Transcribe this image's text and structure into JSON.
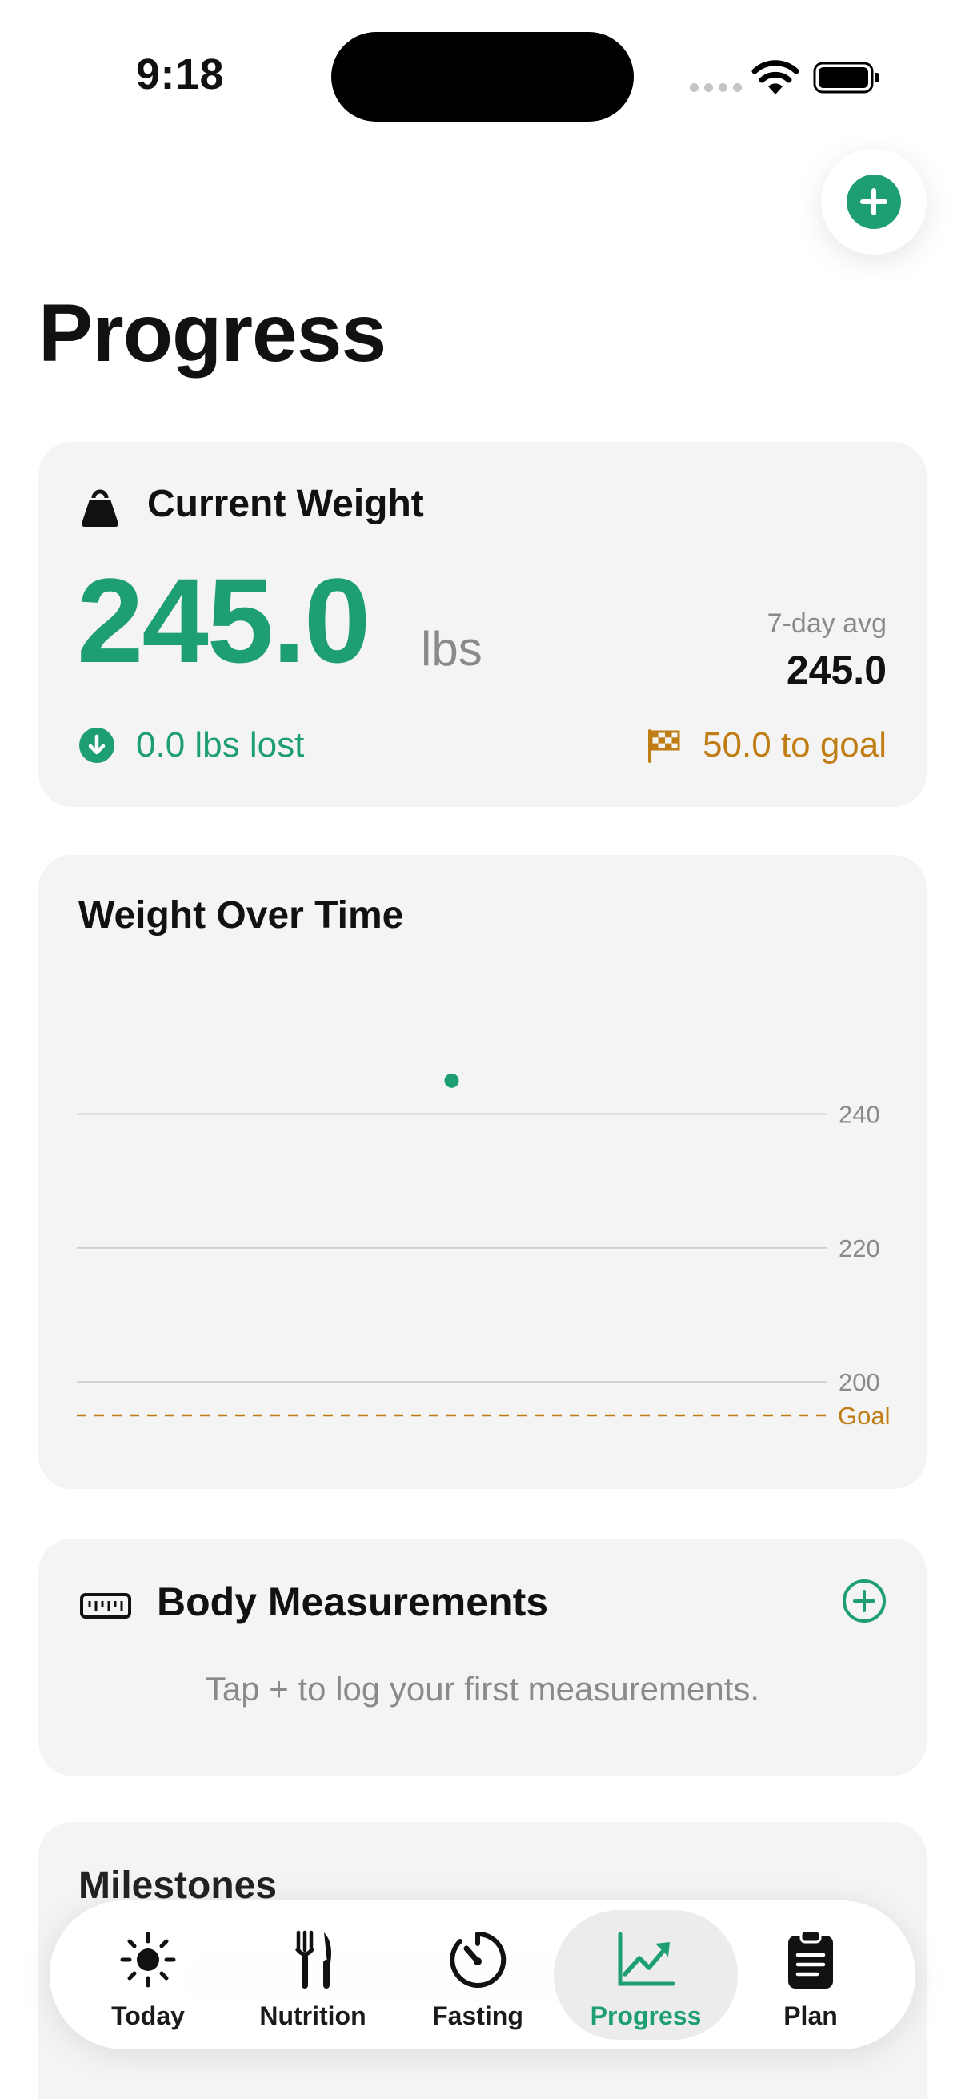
{
  "status_bar": {
    "time": "9:18"
  },
  "header": {
    "title": "Progress",
    "add_icon": "plus-circle-icon"
  },
  "current_weight": {
    "icon": "kettlebell-icon",
    "title": "Current Weight",
    "value": "245.0",
    "unit": "lbs",
    "avg_label": "7-day avg",
    "avg_value": "245.0",
    "lost_text": "0.0 lbs lost",
    "goal_text": "50.0 to goal",
    "accent_color": "#1e9e74",
    "goal_color": "#c07d13"
  },
  "weight_chart": {
    "title": "Weight Over Time",
    "goal_label": "Goal"
  },
  "chart_data": {
    "type": "scatter",
    "title": "Weight Over Time",
    "xlabel": "",
    "ylabel": "",
    "y_ticks": [
      "240",
      "220",
      "200"
    ],
    "ylim": [
      195,
      250
    ],
    "points": [
      {
        "y": 245.0
      }
    ],
    "goal": 195,
    "goal_label": "Goal",
    "grid": true
  },
  "measurements": {
    "title": "Body Measurements",
    "icon": "ruler-icon",
    "add_icon": "plus-circle-outline-icon",
    "empty_text": "Tap + to log your first measurements."
  },
  "milestones": {
    "title": "Milestones"
  },
  "tab_bar": {
    "active": "Progress",
    "items": [
      {
        "label": "Today",
        "icon": "sun-icon"
      },
      {
        "label": "Nutrition",
        "icon": "fork-knife-icon"
      },
      {
        "label": "Fasting",
        "icon": "timer-icon"
      },
      {
        "label": "Progress",
        "icon": "chart-up-icon"
      },
      {
        "label": "Plan",
        "icon": "clipboard-icon"
      }
    ]
  }
}
